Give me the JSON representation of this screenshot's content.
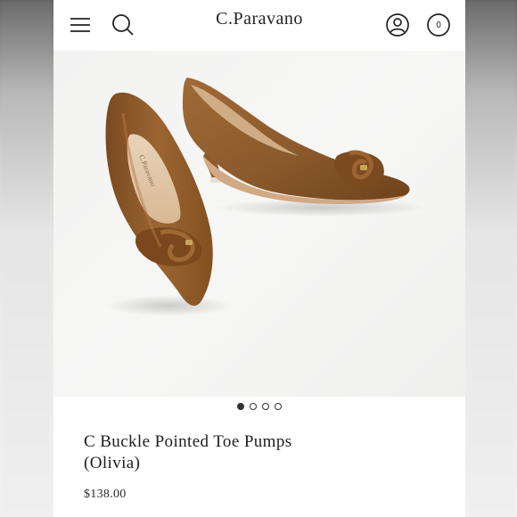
{
  "header": {
    "brand": "C.Paravano",
    "cart_count": "0",
    "icons": [
      "menu-icon",
      "search-icon",
      "account-icon",
      "cart-icon"
    ]
  },
  "gallery": {
    "slide_count": 4,
    "active_index": 0
  },
  "product": {
    "title_line1": "C Buckle Pointed Toe Pumps",
    "title_line2": "(Olivia)",
    "price": "$138.00"
  },
  "colors": {
    "leather": "#8b5a2b",
    "leather_dark": "#6e421c",
    "leather_light": "#a86f3a",
    "background": "#f4f4f3"
  }
}
